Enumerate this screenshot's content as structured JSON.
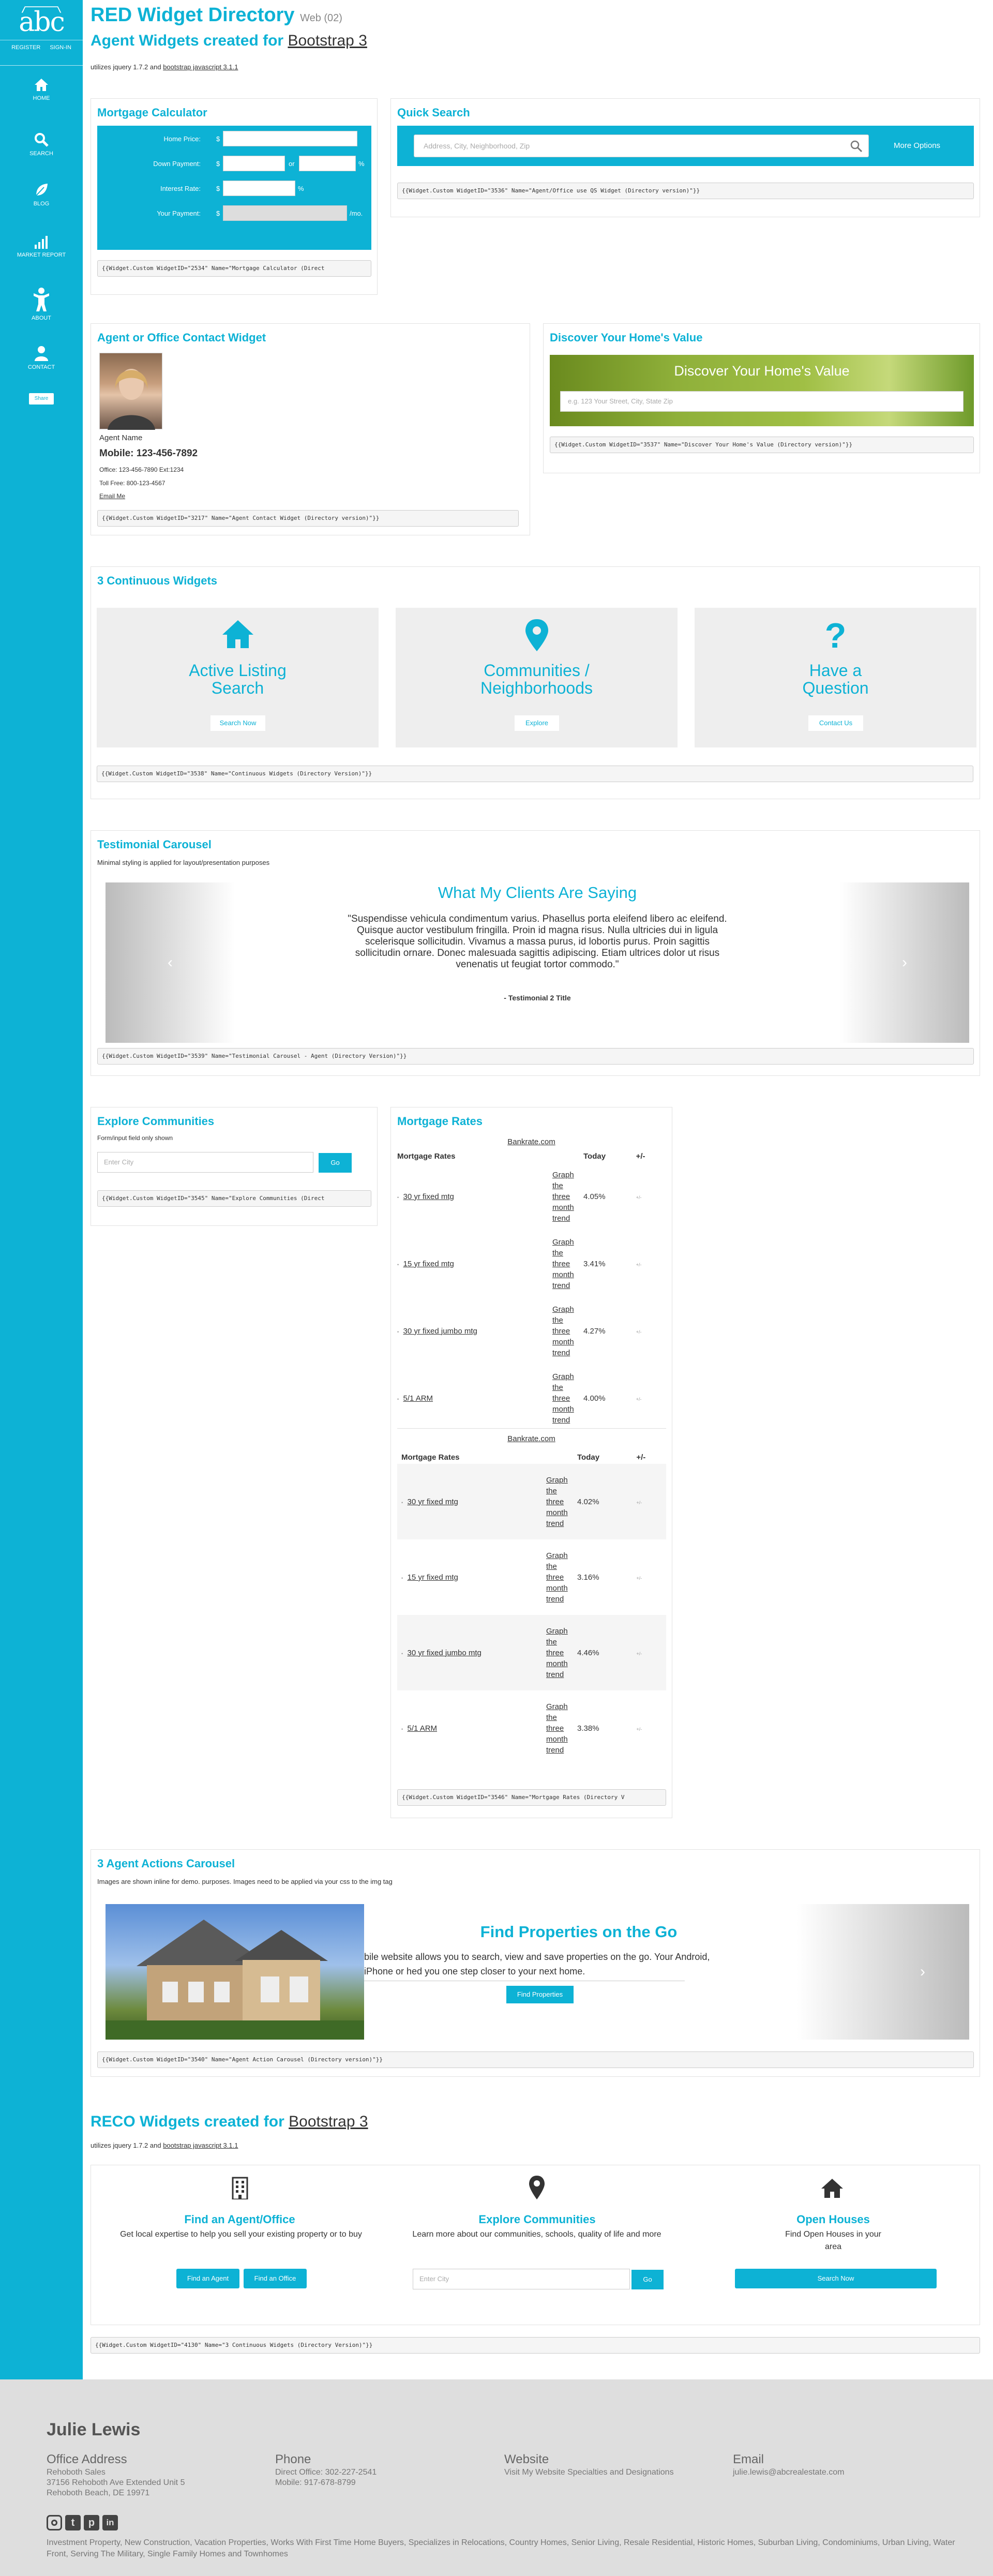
{
  "colors": {
    "accent": "#0db2d5",
    "footer_bg": "#dedede"
  },
  "sidebar": {
    "logo": "abc",
    "register": "REGISTER",
    "signin": "SIGN-IN",
    "nav": [
      {
        "label": "HOME",
        "icon": "home-icon"
      },
      {
        "label": "SEARCH",
        "icon": "search-icon"
      },
      {
        "label": "BLOG",
        "icon": "leaf-icon"
      },
      {
        "label": "MARKET REPORT",
        "icon": "bar-chart-icon"
      },
      {
        "label": "ABOUT",
        "icon": "person-icon"
      },
      {
        "label": "CONTACT",
        "icon": "user-icon"
      }
    ],
    "share": "Share"
  },
  "header": {
    "title": "RED Widget Directory",
    "version": "Web (02)",
    "subtitle_prefix": "Agent Widgets created for ",
    "subtitle_link": "Bootstrap 3",
    "note_pre": "utilizes jquery 1.7.2 and ",
    "note_link": "bootstrap javascript 3.1.1"
  },
  "mortgage_calc": {
    "title": "Mortgage Calculator",
    "home_price": "Home Price:",
    "down_payment": "Down Payment:",
    "interest_rate": "Interest Rate:",
    "your_payment": "Your Payment:",
    "dollar": "$",
    "or": "or",
    "pct": "%",
    "mo": "/mo.",
    "code": "{{Widget.Custom WidgetID=\"2534\" Name=\"Mortgage Calculator (Direct"
  },
  "quick_search": {
    "title": "Quick Search",
    "placeholder": "Address, City, Neighborhood, Zip",
    "more": "More Options",
    "code": "{{Widget.Custom WidgetID=\"3536\" Name=\"Agent/Office use QS Widget (Directory version)\"}}"
  },
  "agent_contact": {
    "title": "Agent or Office Contact Widget",
    "name_label": "Agent Name",
    "mobile": "Mobile: 123-456-7892",
    "office": "Office: 123-456-7890 Ext:1234",
    "tollfree": "Toll Free: 800-123-4567",
    "email": "Email Me",
    "code": "{{Widget.Custom WidgetID=\"3217\" Name=\"Agent Contact Widget (Directory version)\"}}"
  },
  "home_value": {
    "title": "Discover Your Home's Value",
    "banner": "Discover Your Home's Value",
    "placeholder": "e.g. 123 Your Street, City, State Zip",
    "code": "{{Widget.Custom WidgetID=\"3537\" Name=\"Discover Your Home's Value (Directory version)\"}}"
  },
  "continuous": {
    "title": "3 Continuous Widgets",
    "items": [
      {
        "l1": "Active Listing",
        "l2": "Search",
        "btn": "Search Now"
      },
      {
        "l1": "Communities /",
        "l2": "Neighborhoods",
        "btn": "Explore"
      },
      {
        "l1": "Have a",
        "l2": "Question",
        "btn": "Contact Us"
      }
    ],
    "code": "{{Widget.Custom WidgetID=\"3538\" Name=\"Continuous Widgets (Directory Version)\"}}"
  },
  "testimonial": {
    "title": "Testimonial Carousel",
    "note": "Minimal styling is applied for layout/presentation purposes",
    "heading": "What My Clients Are Saying",
    "quote": "\"Suspendisse vehicula condimentum varius. Phasellus porta eleifend libero ac eleifend. Quisque auctor vestibulum fringilla. Proin id magna risus. Nulla ultricies dui in ligula scelerisque sollicitudin. Vivamus a massa purus, id lobortis purus. Proin sagittis sollicitudin ornare. Donec malesuada sagittis adipiscing. Etiam ultrices dolor ut risus venenatis ut feugiat tortor commodo.\"",
    "attrib": "- Testimonial 2 Title",
    "code": "{{Widget.Custom WidgetID=\"3539\" Name=\"Testimonial Carousel - Agent (Directory Version)\"}}"
  },
  "explore": {
    "title": "Explore Communities",
    "note": "Form/input field only shown",
    "placeholder": "Enter City",
    "go": "Go",
    "code": "{{Widget.Custom WidgetID=\"3545\" Name=\"Explore Communities (Direct"
  },
  "rates": {
    "title": "Mortgage Rates",
    "source": "Bankrate.com",
    "col1": "Mortgage Rates",
    "col2": "Today",
    "col3": "+/-",
    "graph": "Graph the three month trend",
    "table1": [
      {
        "name": "30 yr fixed mtg",
        "rate": "4.05%"
      },
      {
        "name": "15 yr fixed mtg",
        "rate": "3.41%"
      },
      {
        "name": "30 yr fixed jumbo mtg",
        "rate": "4.27%"
      },
      {
        "name": "5/1 ARM",
        "rate": "4.00%"
      }
    ],
    "table2": [
      {
        "name": "30 yr fixed mtg",
        "rate": "4.02%"
      },
      {
        "name": "15 yr fixed mtg",
        "rate": "3.16%"
      },
      {
        "name": "30 yr fixed jumbo mtg",
        "rate": "4.46%"
      },
      {
        "name": "5/1 ARM",
        "rate": "3.38%"
      }
    ],
    "code": "{{Widget.Custom WidgetID=\"3546\" Name=\"Mortgage Rates (Directory V"
  },
  "actions": {
    "title": "3 Agent Actions Carousel",
    "note": "Images are shown inline for demo. purposes. Images need to be applied via your css to the img tag",
    "heading": "Find Properties on the Go",
    "text": "bile website allows you to search, view and save properties on the go. Your Android, iPhone or hed you one step closer to your next home.",
    "btn": "Find Properties",
    "code": "{{Widget.Custom WidgetID=\"3540\" Name=\"Agent Action Carousel (Directory version)\"}}"
  },
  "reco": {
    "title_prefix": "RECO Widgets created for ",
    "title_link": "Bootstrap 3",
    "note_pre": "utilizes jquery 1.7.2 and ",
    "note_link": "bootstrap javascript 3.1.1",
    "cols": [
      {
        "title": "Find an Agent/Office",
        "text": "Get local expertise to help you sell your existing property or to buy",
        "btn1": "Find an Agent",
        "btn2": "Find an Office"
      },
      {
        "title": "Explore Communities",
        "text": "Learn more about our communities, schools, quality of life and more",
        "placeholder": "Enter City",
        "go": "Go"
      },
      {
        "title": "Open Houses",
        "text": "Find Open Houses in your area",
        "btn": "Search Now"
      }
    ],
    "code": "{{Widget.Custom WidgetID=\"4130\" Name=\"3 Continuous Widgets (Directory Version)\"}}"
  },
  "footer": {
    "name": "Julie Lewis",
    "office_h": "Office Address",
    "office_1": "Rehoboth Sales",
    "office_2": "37156 Rehoboth Ave Extended Unit 5",
    "office_3": "Rehoboth Beach, DE 19971",
    "phone_h": "Phone",
    "phone_1": "Direct Office: 302-227-2541",
    "phone_2": "Mobile: 917-678-8799",
    "web_h": "Website",
    "web_1": "Visit My Website Specialties and Designations",
    "email_h": "Email",
    "email_1": "julie.lewis@abcrealestate.com",
    "keywords": "Investment Property, New Construction, Vacation Properties, Works With First Time Home Buyers, Specializes in Relocations, Country Homes, Senior Living, Resale Residential, Historic Homes, Suburban Living, Condominiums, Urban Living, Water Front, Serving The Military, Single Family Homes and Townhomes"
  }
}
